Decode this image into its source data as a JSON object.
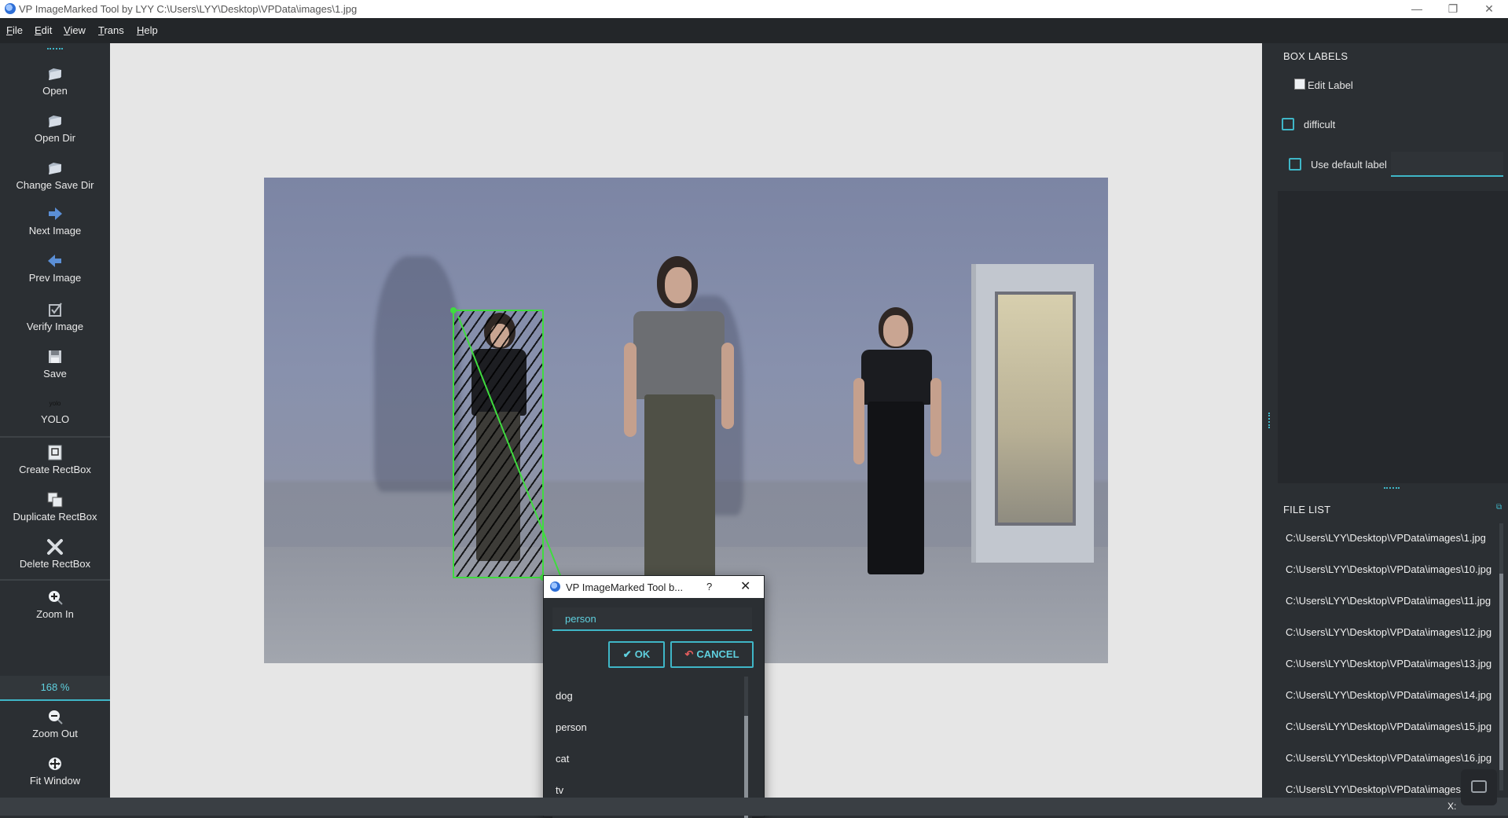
{
  "window": {
    "title": "VP ImageMarked Tool by LYY C:\\Users\\LYY\\Desktop\\VPData\\images\\1.jpg",
    "controls": [
      "—",
      "❐",
      "✕"
    ]
  },
  "menu": [
    "File",
    "Edit",
    "View",
    "Trans",
    "Help"
  ],
  "toolbar": {
    "items": [
      {
        "label": "Open",
        "icon": "folder-open-icon"
      },
      {
        "label": "Open Dir",
        "icon": "folder-open-icon"
      },
      {
        "label": "Change Save Dir",
        "icon": "folder-open-icon"
      },
      {
        "label": "Next Image",
        "icon": "arrow-right-icon"
      },
      {
        "label": "Prev Image",
        "icon": "arrow-left-icon"
      },
      {
        "label": "Verify Image",
        "icon": "checkbox-icon"
      },
      {
        "label": "Save",
        "icon": "save-icon"
      },
      {
        "label": "YOLO",
        "icon": "yolo-format-icon",
        "icon_text": "yolo"
      },
      {
        "label": "Create RectBox",
        "icon": "create-rectbox-icon"
      },
      {
        "label": "Duplicate RectBox",
        "icon": "duplicate-rectbox-icon"
      },
      {
        "label": "Delete RectBox",
        "icon": "delete-rectbox-icon"
      },
      {
        "label": "Zoom In",
        "icon": "zoom-in-icon"
      },
      {
        "label": "Zoom Out",
        "icon": "zoom-out-icon"
      },
      {
        "label": "Fit Window",
        "icon": "fit-window-icon"
      }
    ],
    "zoom_value": "168 %"
  },
  "dialog": {
    "title": "VP ImageMarked Tool b...",
    "help": "?",
    "close": "✕",
    "input_value": "person",
    "ok_label": "OK",
    "cancel_label": "CANCEL",
    "labels": [
      "dog",
      "person",
      "cat",
      "tv"
    ]
  },
  "right_panel": {
    "box_labels_title": "BOX LABELS",
    "edit_label": "Edit Label",
    "difficult_label": "difficult",
    "difficult_checked": false,
    "use_default_label": "Use default label",
    "use_default_checked": false,
    "default_label_value": "",
    "file_list_title": "FILE LIST",
    "files": [
      "C:\\Users\\LYY\\Desktop\\VPData\\images\\1.jpg",
      "C:\\Users\\LYY\\Desktop\\VPData\\images\\10.jpg",
      "C:\\Users\\LYY\\Desktop\\VPData\\images\\11.jpg",
      "C:\\Users\\LYY\\Desktop\\VPData\\images\\12.jpg",
      "C:\\Users\\LYY\\Desktop\\VPData\\images\\13.jpg",
      "C:\\Users\\LYY\\Desktop\\VPData\\images\\14.jpg",
      "C:\\Users\\LYY\\Desktop\\VPData\\images\\15.jpg",
      "C:\\Users\\LYY\\Desktop\\VPData\\images\\16.jpg",
      "C:\\Users\\LYY\\Desktop\\VPData\\images"
    ]
  },
  "status": {
    "coord": "X:"
  },
  "colors": {
    "accent": "#3fb6c7",
    "accent_text": "#5fd0df",
    "bbox": "#3fdc3f",
    "panel_bg": "#2b2f33",
    "canvas_bg": "#e6e6e6"
  }
}
